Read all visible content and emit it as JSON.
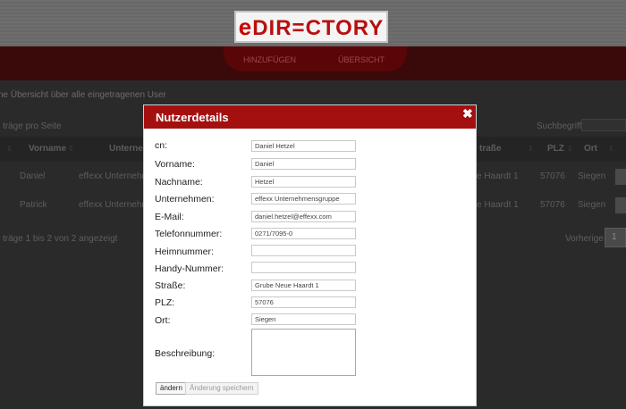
{
  "logo": {
    "e": "e",
    "text": "DIR",
    "eq": "=",
    "text2": "CTORY"
  },
  "nav": {
    "add": "HINZUFÜGEN",
    "overview": "ÜBERSICHT"
  },
  "page": {
    "subtitle": "ne Übersicht über alle eingetragenen User",
    "per_page": "träge pro Seite",
    "search_label": "Suchbegriff",
    "info": "träge 1 bis 2 von 2 angezeigt",
    "prev": "Vorherige",
    "page_num": "1"
  },
  "table": {
    "headers": {
      "vorname": "Vorname",
      "unternehmen": "Unternei",
      "strasse": "traße",
      "plz": "PLZ",
      "ort": "Ort"
    },
    "rows": [
      {
        "vorname": "Daniel",
        "unternehmen": "effexx Unternehme",
        "strasse": "e Haardt 1",
        "plz": "57076",
        "ort": "Siegen"
      },
      {
        "vorname": "Patrick",
        "unternehmen": "effexx Unternehme",
        "strasse": "e Haardt 1",
        "plz": "57076",
        "ort": "Siegen"
      }
    ]
  },
  "modal": {
    "title": "Nutzerdetails",
    "close": "✖",
    "fields": [
      {
        "label": "cn:",
        "value": "Daniel Hetzel"
      },
      {
        "label": "Vorname:",
        "value": "Daniel"
      },
      {
        "label": "Nachname:",
        "value": "Hetzel"
      },
      {
        "label": "Unternehmen:",
        "value": "effexx Unternehmensgruppe"
      },
      {
        "label": "E-Mail:",
        "value": "daniel.hetzel@effexx.com"
      },
      {
        "label": "Telefonnummer:",
        "value": "0271/7095-0"
      },
      {
        "label": "Heimnummer:",
        "value": ""
      },
      {
        "label": "Handy-Nummer:",
        "value": ""
      },
      {
        "label": "Straße:",
        "value": "Grube Neue Haardt 1"
      },
      {
        "label": "PLZ:",
        "value": "57076"
      },
      {
        "label": "Ort:",
        "value": "Siegen"
      }
    ],
    "description_label": "Beschreibung:",
    "description_value": "",
    "change_button": "ändern",
    "save_button": "Änderung speichern"
  },
  "colors": {
    "accent": "#a41010",
    "navbar": "#3a0a0a",
    "backdrop": "#2a2a2a"
  }
}
